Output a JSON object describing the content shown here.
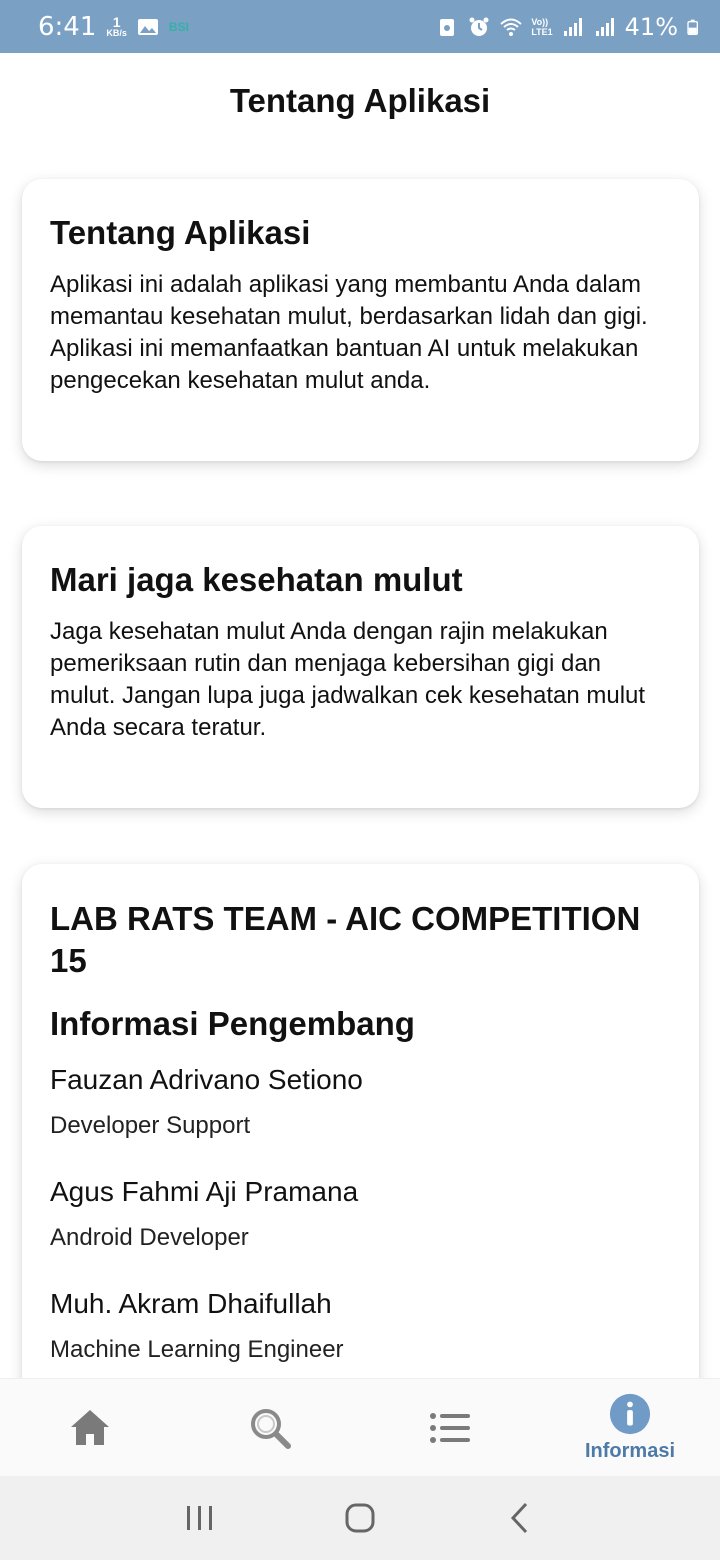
{
  "status_bar": {
    "time": "6:41",
    "net_speed_value": "1",
    "net_speed_unit": "KB/s",
    "bsi": "BSI",
    "volte_top": "Vo))",
    "volte_bottom": "LTE1",
    "battery": "41%"
  },
  "header": {
    "title": "Tentang Aplikasi"
  },
  "cards": [
    {
      "title": "Tentang Aplikasi",
      "body": "Aplikasi ini adalah aplikasi yang membantu Anda dalam memantau kesehatan mulut, berdasarkan lidah dan gigi. Aplikasi ini memanfaatkan bantuan AI untuk melakukan pengecekan kesehatan mulut anda."
    },
    {
      "title": "Mari jaga kesehatan mulut",
      "body": "Jaga kesehatan mulut Anda dengan rajin melakukan pemeriksaan rutin dan menjaga kebersihan gigi dan mulut. Jangan lupa juga jadwalkan cek kesehatan mulut Anda secara teratur."
    }
  ],
  "team": {
    "title": "LAB RATS TEAM - AIC COMPETITION 15",
    "heading": "Informasi Pengembang",
    "developers": [
      {
        "name": "Fauzan Adrivano Setiono",
        "role": "Developer Support"
      },
      {
        "name": "Agus Fahmi Aji Pramana",
        "role": "Android Developer"
      },
      {
        "name": "Muh. Akram Dhaifullah",
        "role": "Machine Learning Engineer"
      }
    ]
  },
  "bottom_nav": {
    "items": [
      {
        "icon": "home-icon"
      },
      {
        "icon": "search-icon"
      },
      {
        "icon": "list-icon"
      },
      {
        "icon": "info-icon",
        "label": "Informasi",
        "active": true
      }
    ]
  },
  "colors": {
    "status_bar": "#7aa0c4",
    "active_nav": "#4d7aa7",
    "inactive_nav": "#7a7a7a"
  }
}
